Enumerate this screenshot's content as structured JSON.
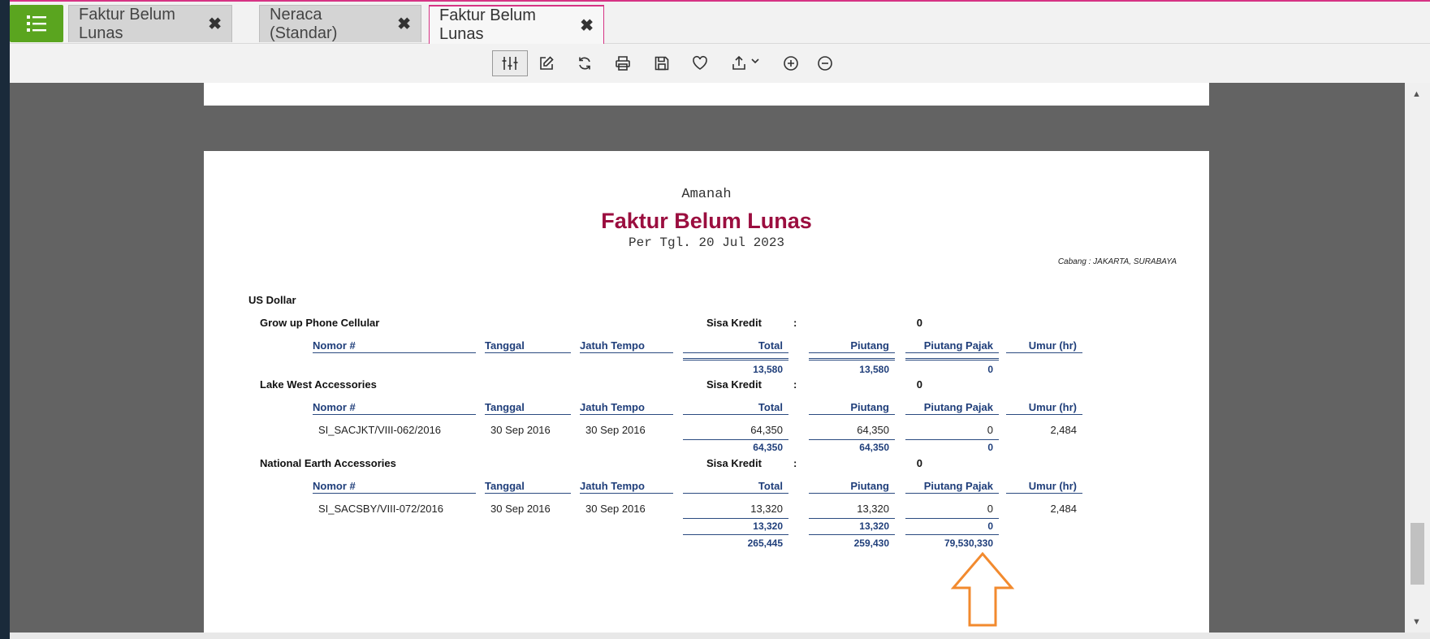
{
  "tabs": [
    {
      "label": "Faktur Belum Lunas",
      "close": "✖"
    },
    {
      "label": "Neraca (Standar)",
      "close": "✖"
    },
    {
      "label": "Faktur Belum Lunas",
      "close": "✖"
    }
  ],
  "report": {
    "company": "Amanah",
    "title": "Faktur Belum Lunas",
    "date": "Per Tgl. 20 Jul 2023",
    "cabang": "Cabang : JAKARTA, SURABAYA",
    "currency": "US Dollar",
    "headers": {
      "nomor": "Nomor #",
      "tanggal": "Tanggal",
      "jatuh_tempo": "Jatuh Tempo",
      "total": "Total",
      "piutang": "Piutang",
      "piutang_pajak": "Piutang Pajak",
      "umur": "Umur (hr)"
    },
    "sisa_kredit_label": "Sisa Kredit",
    "colon": ":",
    "customers": [
      {
        "name": "Grow up Phone Cellular",
        "sisa_kredit": "0",
        "rows": [],
        "subtotal": {
          "total": "13,580",
          "piutang": "13,580",
          "pajak": "0"
        }
      },
      {
        "name": "Lake West Accessories",
        "sisa_kredit": "0",
        "rows": [
          {
            "nomor": "SI_SACJKT/VIII-062/2016",
            "tanggal": "30 Sep 2016",
            "jatuh_tempo": "30 Sep 2016",
            "total": "64,350",
            "piutang": "64,350",
            "pajak": "0",
            "umur": "2,484"
          }
        ],
        "subtotal": {
          "total": "64,350",
          "piutang": "64,350",
          "pajak": "0"
        }
      },
      {
        "name": "National Earth Accessories",
        "sisa_kredit": "0",
        "rows": [
          {
            "nomor": "SI_SACSBY/VIII-072/2016",
            "tanggal": "30 Sep 2016",
            "jatuh_tempo": "30 Sep 2016",
            "total": "13,320",
            "piutang": "13,320",
            "pajak": "0",
            "umur": "2,484"
          }
        ],
        "subtotal": {
          "total": "13,320",
          "piutang": "13,320",
          "pajak": "0"
        }
      }
    ],
    "grand_total": {
      "total": "265,445",
      "piutang": "259,430",
      "pajak": "79,530,330"
    }
  },
  "colors": {
    "accent": "#5aa51f",
    "title": "#9b0e3f",
    "header": "#1f3e7a",
    "active_tab_border": "#d63384",
    "annotation_arrow": "#f28a2e"
  }
}
